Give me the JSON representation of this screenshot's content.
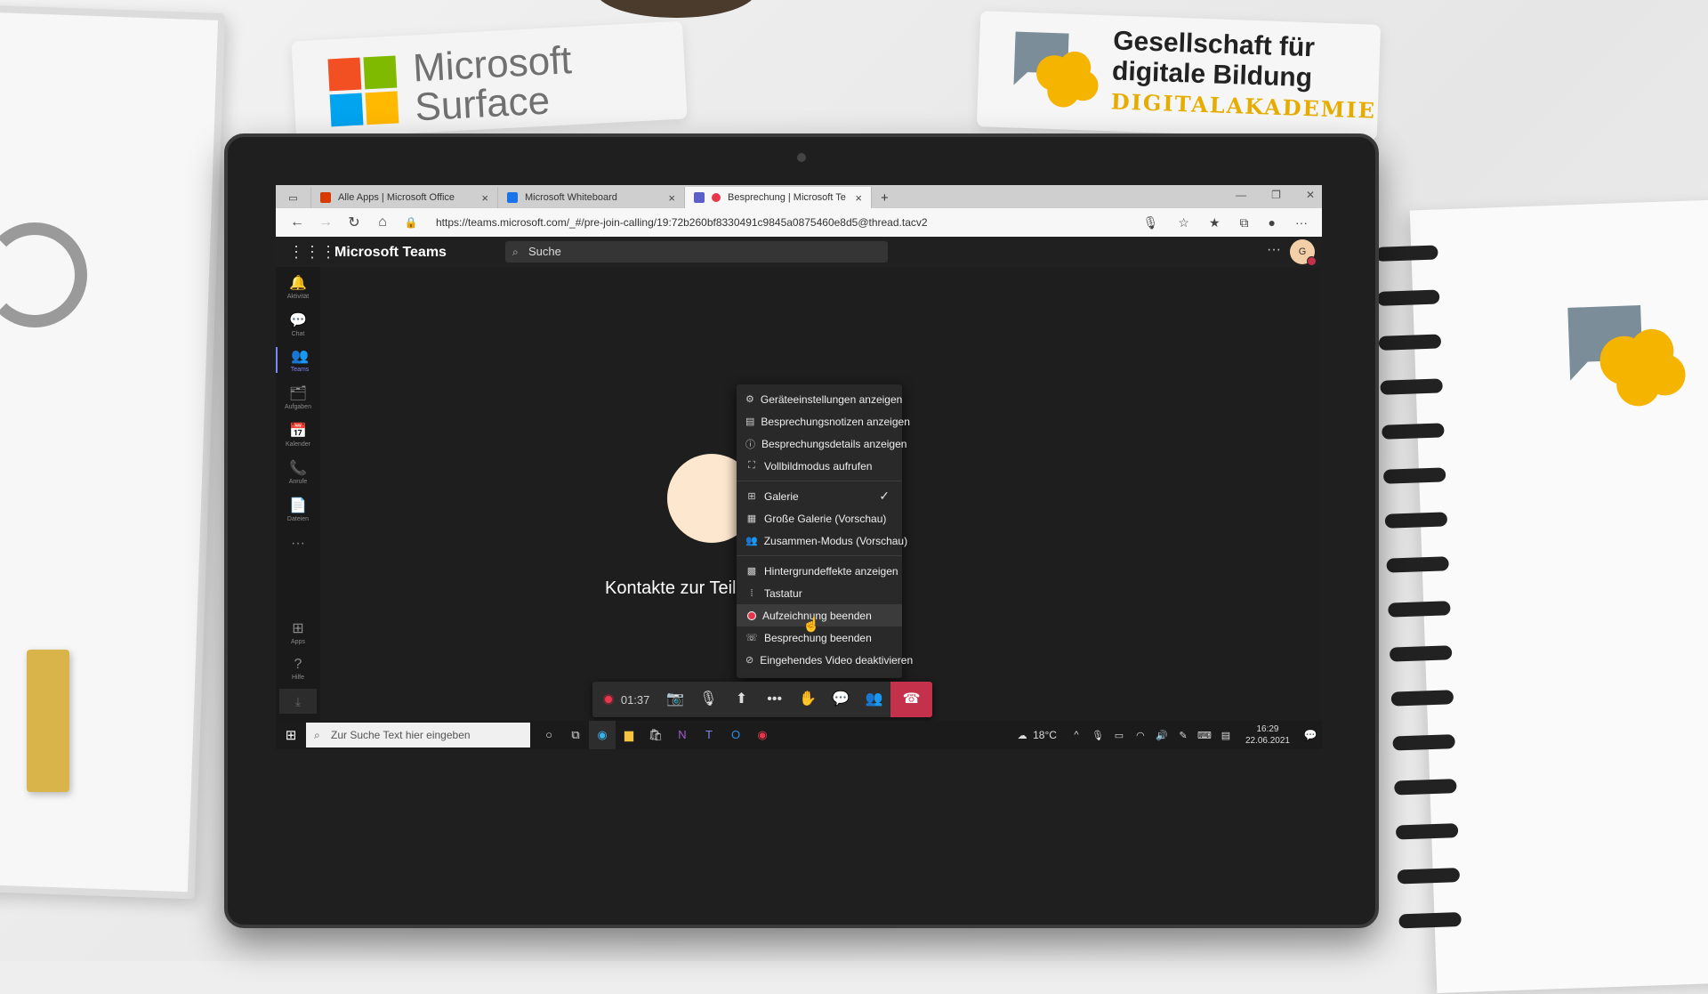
{
  "props": {
    "surface_label": "Microsoft Surface",
    "gdb_title_line1": "Gesellschaft für",
    "gdb_title_line2": "digitale Bildung",
    "gdb_sub": "DIGITALAKADEMIE"
  },
  "browser": {
    "tabs": [
      {
        "label": "Alle Apps | Microsoft Office",
        "close": "×",
        "favicon_color": "#d83b01"
      },
      {
        "label": "Microsoft Whiteboard",
        "close": "×",
        "favicon_color": "#1a73e8"
      },
      {
        "label": "Besprechung | Microsoft Te",
        "close": "×",
        "favicon_color": "#5b5fc7"
      }
    ],
    "new_tab": "+",
    "url": "https://teams.microsoft.com/_#/pre-join-calling/19:72b260bf8330491c9845a0875460e8d5@thread.tacv2"
  },
  "teams": {
    "title": "Microsoft Teams",
    "search_placeholder": "Suche",
    "more": "···",
    "avatar_initial": "G",
    "rail": [
      {
        "label": "Aktivität",
        "icon": "bell-icon",
        "glyph": "🔔"
      },
      {
        "label": "Chat",
        "icon": "chat-icon",
        "glyph": "💬"
      },
      {
        "label": "Teams",
        "icon": "teams-icon",
        "glyph": "👥"
      },
      {
        "label": "Aufgaben",
        "icon": "tasks-icon",
        "glyph": "🗂"
      },
      {
        "label": "Kalender",
        "icon": "calendar-icon",
        "glyph": "📅"
      },
      {
        "label": "Anrufe",
        "icon": "phone-icon",
        "glyph": "📞"
      },
      {
        "label": "Dateien",
        "icon": "files-icon",
        "glyph": "📄"
      },
      {
        "label": "",
        "icon": "more-icon",
        "glyph": "···"
      },
      {
        "label": "Apps",
        "icon": "apps-icon",
        "glyph": "⊞"
      },
      {
        "label": "Hilfe",
        "icon": "help-icon",
        "glyph": "?"
      }
    ],
    "invite_text": "Kontakte zur Teilnahme einladen",
    "call_timer": "01:37",
    "menu": {
      "section1": [
        {
          "label": "Geräteeinstellungen anzeigen",
          "icon": "gear-icon",
          "glyph": "⚙"
        },
        {
          "label": "Besprechungsnotizen anzeigen",
          "icon": "notes-icon",
          "glyph": "▤"
        },
        {
          "label": "Besprechungsdetails anzeigen",
          "icon": "info-icon",
          "glyph": "ⓘ"
        },
        {
          "label": "Vollbildmodus aufrufen",
          "icon": "fullscreen-icon",
          "glyph": "⛶"
        }
      ],
      "section2": [
        {
          "label": "Galerie",
          "icon": "gallery-icon",
          "glyph": "⊞",
          "checked": true
        },
        {
          "label": "Große Galerie (Vorschau)",
          "icon": "large-gallery-icon",
          "glyph": "▦"
        },
        {
          "label": "Zusammen-Modus (Vorschau)",
          "icon": "together-mode-icon",
          "glyph": "👥"
        }
      ],
      "section3": [
        {
          "label": "Hintergrundeffekte anzeigen",
          "icon": "background-effects-icon",
          "glyph": "▩"
        },
        {
          "label": "Tastatur",
          "icon": "keypad-icon",
          "glyph": "⁞"
        },
        {
          "label": "Aufzeichnung beenden",
          "icon": "record-stop-icon",
          "glyph": ""
        },
        {
          "label": "Besprechung beenden",
          "icon": "end-meeting-icon",
          "glyph": "☏"
        },
        {
          "label": "Eingehendes Video deaktivieren",
          "icon": "video-off-icon",
          "glyph": "⊘"
        }
      ],
      "check": "✓"
    }
  },
  "taskbar": {
    "search_placeholder": "Zur Suche Text hier eingeben",
    "temperature": "18°C",
    "time": "16:29",
    "date": "22.06.2021"
  }
}
